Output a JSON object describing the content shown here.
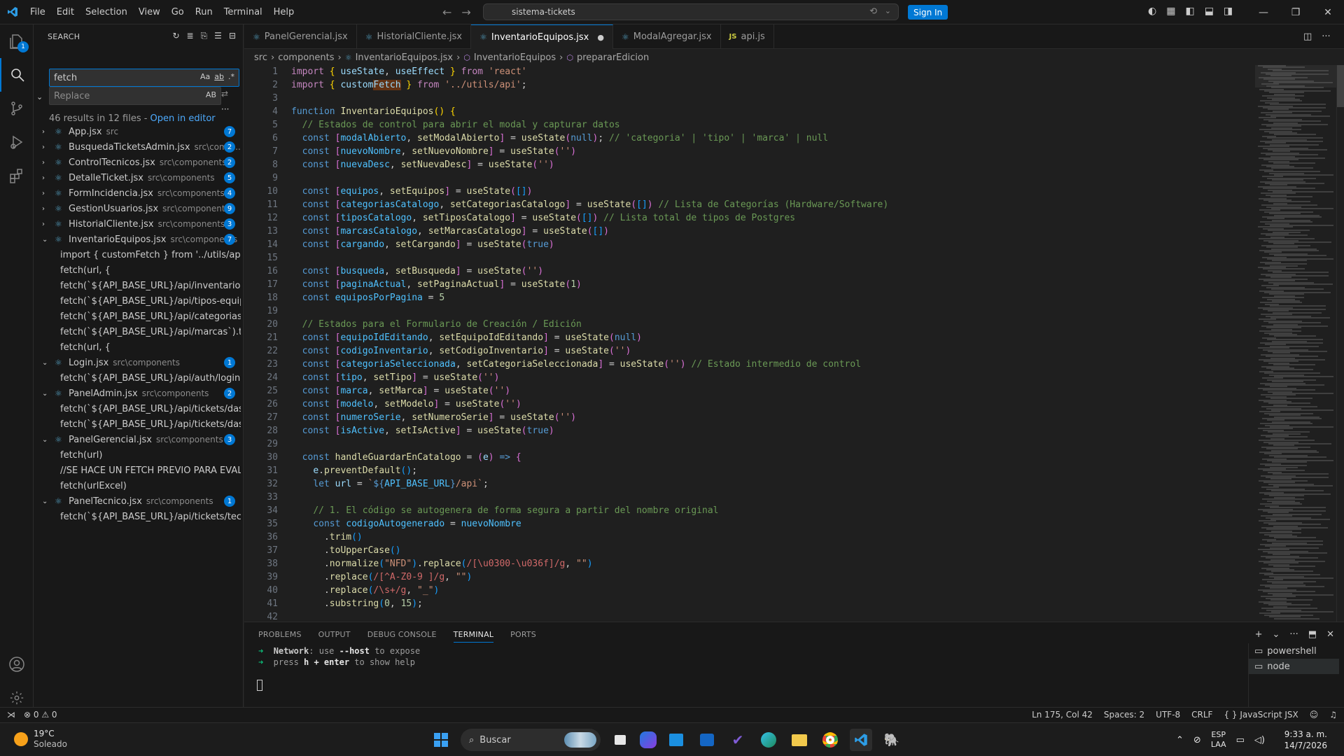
{
  "titlebar": {
    "menu": [
      "File",
      "Edit",
      "Selection",
      "View",
      "Go",
      "Run",
      "Terminal",
      "Help"
    ],
    "search_text": "sistema-tickets",
    "sign_in": "Sign In"
  },
  "activity": {
    "explorer_badge": "1"
  },
  "sidebar": {
    "title": "SEARCH",
    "search_value": "fetch",
    "replace_placeholder": "Replace",
    "replace_preserve_case": "AB",
    "summary": "46 results in 12 files - ",
    "open_in_editor": "Open in editor",
    "results": [
      {
        "name": "App.jsx",
        "path": "src",
        "count": "7",
        "expanded": false
      },
      {
        "name": "BusquedaTicketsAdmin.jsx",
        "path": "src\\comp...",
        "count": "2",
        "expanded": false
      },
      {
        "name": "ControlTecnicos.jsx",
        "path": "src\\components",
        "count": "2",
        "expanded": false
      },
      {
        "name": "DetalleTicket.jsx",
        "path": "src\\components",
        "count": "5",
        "expanded": false
      },
      {
        "name": "FormIncidencia.jsx",
        "path": "src\\components",
        "count": "4",
        "expanded": false
      },
      {
        "name": "GestionUsuarios.jsx",
        "path": "src\\components",
        "count": "9",
        "expanded": false
      },
      {
        "name": "HistorialCliente.jsx",
        "path": "src\\components",
        "count": "3",
        "expanded": false
      },
      {
        "name": "InventarioEquipos.jsx",
        "path": "src\\components",
        "count": "7",
        "expanded": true,
        "lines": [
          "import { customFetch } from '../utils/api';",
          "fetch(url, {",
          "fetch(`${API_BASE_URL}/api/inventario`).the...",
          "fetch(`${API_BASE_URL}/api/tipos-equipos-...",
          "fetch(`${API_BASE_URL}/api/categorias-inve...",
          "fetch(`${API_BASE_URL}/api/marcas`).then(r...",
          "fetch(url, {"
        ]
      },
      {
        "name": "Login.jsx",
        "path": "src\\components",
        "count": "1",
        "expanded": true,
        "lines": [
          "fetch(`${API_BASE_URL}/api/auth/login`, {"
        ]
      },
      {
        "name": "PanelAdmin.jsx",
        "path": "src\\components",
        "count": "2",
        "expanded": true,
        "lines": [
          "fetch(`${API_BASE_URL}/api/tickets/dashboa...",
          "fetch(`${API_BASE_URL}/api/tickets/dashboa..."
        ]
      },
      {
        "name": "PanelGerencial.jsx",
        "path": "src\\components",
        "count": "3",
        "expanded": true,
        "lines": [
          "fetch(url)",
          "//SE HACE UN FETCH PREVIO PARA EVALUA...",
          "fetch(urlExcel)"
        ]
      },
      {
        "name": "PanelTecnico.jsx",
        "path": "src\\components",
        "count": "1",
        "expanded": true,
        "lines": [
          "fetch(`${API_BASE_URL}/api/tickets/tecnico`)"
        ]
      }
    ]
  },
  "tabs": [
    {
      "label": "PanelGerencial.jsx",
      "type": "react",
      "active": false
    },
    {
      "label": "HistorialCliente.jsx",
      "type": "react",
      "active": false
    },
    {
      "label": "InventarioEquipos.jsx",
      "type": "react",
      "active": true,
      "modified": true
    },
    {
      "label": "ModalAgregar.jsx",
      "type": "react",
      "active": false
    },
    {
      "label": "api.js",
      "type": "js",
      "active": false
    }
  ],
  "breadcrumb": [
    "src",
    "components",
    "InventarioEquipos.jsx",
    "InventarioEquipos",
    "prepararEdicion"
  ],
  "code": {
    "line_numbers": [
      "1",
      "2",
      "3",
      "4",
      "5",
      "6",
      "7",
      "8",
      "9",
      "10",
      "11",
      "12",
      "13",
      "14",
      "15",
      "16",
      "17",
      "18",
      "19",
      "20",
      "21",
      "22",
      "23",
      "24",
      "25",
      "26",
      "27",
      "28",
      "29",
      "30",
      "31",
      "32",
      "33",
      "34",
      "35",
      "36",
      "37",
      "38",
      "39",
      "40",
      "41",
      "42"
    ]
  },
  "panel": {
    "tabs": [
      "PROBLEMS",
      "OUTPUT",
      "DEBUG CONSOLE",
      "TERMINAL",
      "PORTS"
    ],
    "active_tab": "TERMINAL",
    "terminal_lines": [
      "➜  Network: use --host to expose",
      "➜  press h + enter to show help"
    ],
    "terminals": [
      "powershell",
      "node"
    ]
  },
  "statusbar": {
    "errors": "0",
    "warnings": "0",
    "position": "Ln 175, Col 42",
    "spaces": "Spaces: 2",
    "encoding": "UTF-8",
    "eol": "CRLF",
    "language": "JavaScript JSX"
  },
  "taskbar": {
    "temp": "19°C",
    "weather": "Soleado",
    "search_placeholder": "Buscar",
    "lang_1": "ESP",
    "lang_2": "LAA",
    "time": "9:33 a. m.",
    "date": "14/7/2026"
  }
}
